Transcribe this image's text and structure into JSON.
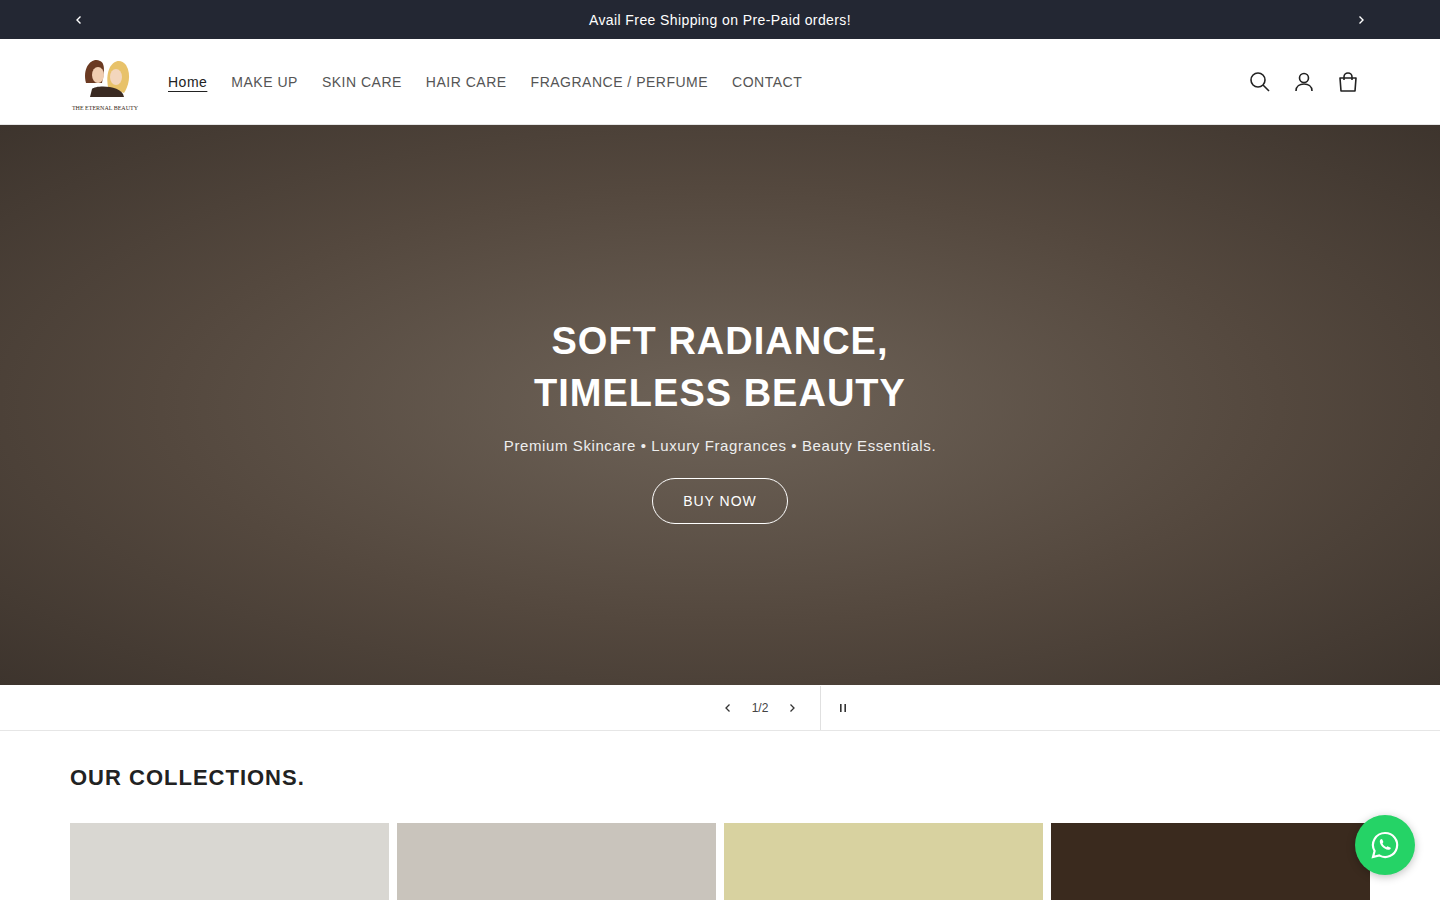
{
  "announcement": {
    "text": "Avail Free Shipping on Pre-Paid orders!"
  },
  "logo": {
    "caption": "THE ETERNAL BEAUTY"
  },
  "nav": [
    {
      "label": "Home",
      "selected": true
    },
    {
      "label": "MAKE UP",
      "selected": false
    },
    {
      "label": "SKIN CARE",
      "selected": false
    },
    {
      "label": "HAIR CARE",
      "selected": false
    },
    {
      "label": "FRAGRANCE / PERFUME",
      "selected": false
    },
    {
      "label": "CONTACT",
      "selected": false
    }
  ],
  "hero": {
    "title": "SOFT RADIANCE, TIMELESS BEAUTY",
    "subtitle": "Premium Skincare • Luxury Fragrances • Beauty Essentials.",
    "button": "BUY NOW"
  },
  "slider": {
    "counter": "1/2",
    "playing": true
  },
  "collections": {
    "title": "OUR COLLECTIONS.",
    "cards": [
      {
        "color": "#d9d7d2"
      },
      {
        "color": "#c9c4bc"
      },
      {
        "color": "#d8d2a0"
      },
      {
        "color": "#3a2a1e"
      }
    ]
  }
}
